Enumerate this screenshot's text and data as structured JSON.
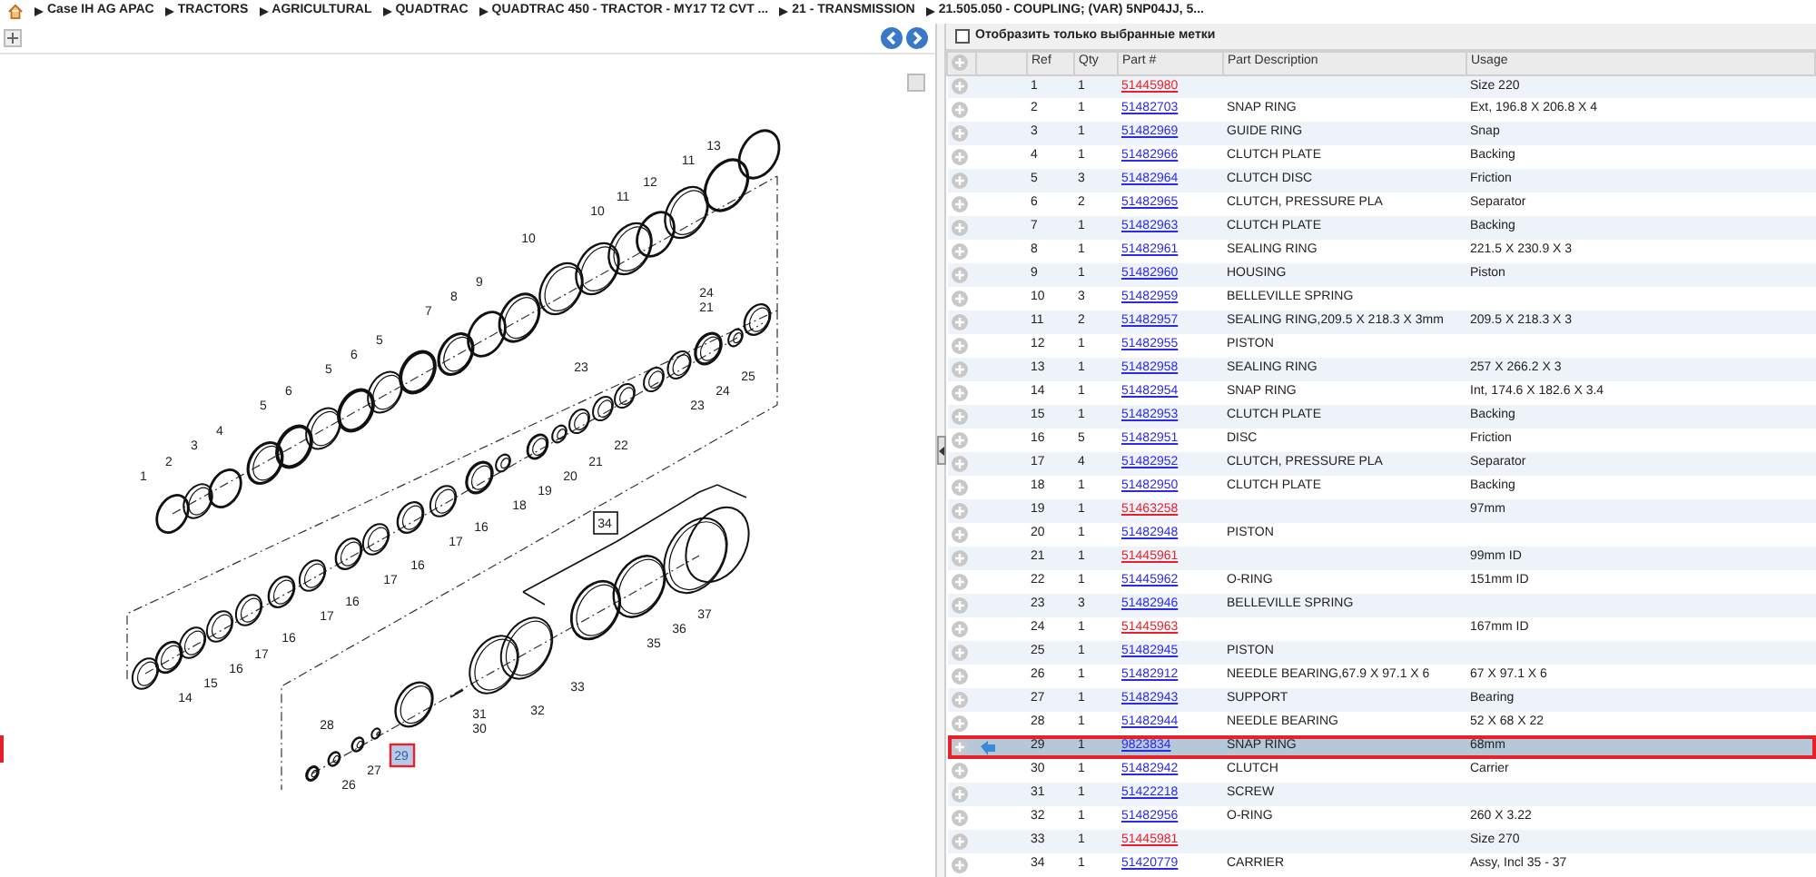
{
  "breadcrumb": [
    "Case IH AG APAC",
    "TRACTORS",
    "AGRICULTURAL",
    "QUADTRAC",
    "QUADTRAC 450 - TRACTOR - MY17 T2 CVT ...",
    "21 - TRANSMISSION",
    "21.505.050 - COUPLING; (VAR) 5NP04JJ, 5..."
  ],
  "diagram": {
    "callouts": [
      {
        "label": "1",
        "selected": false,
        "kind": "plain"
      },
      {
        "label": "2",
        "selected": false,
        "kind": "plain"
      },
      {
        "label": "3",
        "selected": false,
        "kind": "plain"
      },
      {
        "label": "4",
        "selected": false,
        "kind": "plain"
      },
      {
        "label": "5",
        "selected": false,
        "kind": "plain"
      },
      {
        "label": "6",
        "selected": false,
        "kind": "plain"
      },
      {
        "label": "5",
        "selected": false,
        "kind": "plain"
      },
      {
        "label": "6",
        "selected": false,
        "kind": "plain"
      },
      {
        "label": "5",
        "selected": false,
        "kind": "plain"
      },
      {
        "label": "7",
        "selected": false,
        "kind": "plain"
      },
      {
        "label": "8",
        "selected": false,
        "kind": "plain"
      },
      {
        "label": "9",
        "selected": false,
        "kind": "plain"
      },
      {
        "label": "10",
        "selected": false,
        "kind": "plain"
      },
      {
        "label": "10",
        "selected": false,
        "kind": "plain"
      },
      {
        "label": "11",
        "selected": false,
        "kind": "plain"
      },
      {
        "label": "12",
        "selected": false,
        "kind": "plain"
      },
      {
        "label": "11",
        "selected": false,
        "kind": "plain"
      },
      {
        "label": "13",
        "selected": false,
        "kind": "plain"
      },
      {
        "label": "24",
        "selected": false,
        "kind": "plain"
      },
      {
        "label": "21",
        "selected": false,
        "kind": "plain"
      },
      {
        "label": "25",
        "selected": false,
        "kind": "plain"
      },
      {
        "label": "24",
        "selected": false,
        "kind": "plain"
      },
      {
        "label": "23",
        "selected": false,
        "kind": "plain"
      },
      {
        "label": "23",
        "selected": false,
        "kind": "plain"
      },
      {
        "label": "22",
        "selected": false,
        "kind": "plain"
      },
      {
        "label": "21",
        "selected": false,
        "kind": "plain"
      },
      {
        "label": "20",
        "selected": false,
        "kind": "plain"
      },
      {
        "label": "19",
        "selected": false,
        "kind": "plain"
      },
      {
        "label": "18",
        "selected": false,
        "kind": "plain"
      },
      {
        "label": "16",
        "selected": false,
        "kind": "plain"
      },
      {
        "label": "17",
        "selected": false,
        "kind": "plain"
      },
      {
        "label": "16",
        "selected": false,
        "kind": "plain"
      },
      {
        "label": "17",
        "selected": false,
        "kind": "plain"
      },
      {
        "label": "16",
        "selected": false,
        "kind": "plain"
      },
      {
        "label": "17",
        "selected": false,
        "kind": "plain"
      },
      {
        "label": "16",
        "selected": false,
        "kind": "plain"
      },
      {
        "label": "17",
        "selected": false,
        "kind": "plain"
      },
      {
        "label": "16",
        "selected": false,
        "kind": "plain"
      },
      {
        "label": "15",
        "selected": false,
        "kind": "plain"
      },
      {
        "label": "14",
        "selected": false,
        "kind": "plain"
      },
      {
        "label": "34",
        "selected": false,
        "kind": "boxed"
      },
      {
        "label": "37",
        "selected": false,
        "kind": "plain"
      },
      {
        "label": "36",
        "selected": false,
        "kind": "plain"
      },
      {
        "label": "35",
        "selected": false,
        "kind": "plain"
      },
      {
        "label": "33",
        "selected": false,
        "kind": "plain"
      },
      {
        "label": "32",
        "selected": false,
        "kind": "plain"
      },
      {
        "label": "31",
        "selected": false,
        "kind": "plain"
      },
      {
        "label": "30",
        "selected": false,
        "kind": "plain"
      },
      {
        "label": "28",
        "selected": false,
        "kind": "plain"
      },
      {
        "label": "29",
        "selected": true,
        "kind": "plain"
      },
      {
        "label": "27",
        "selected": false,
        "kind": "plain"
      },
      {
        "label": "26",
        "selected": false,
        "kind": "plain"
      }
    ]
  },
  "filter": {
    "label": "Отобразить только выбранные метки",
    "checked": false
  },
  "table": {
    "columns": [
      "Ref",
      "Qty",
      "Part #",
      "Part Description",
      "Usage"
    ],
    "rows": [
      {
        "ref": "1",
        "qty": "1",
        "part": "51445980",
        "color": "#e8202a",
        "description": "",
        "usage": "Size 220",
        "selected": false
      },
      {
        "ref": "2",
        "qty": "1",
        "part": "51482703",
        "color": "#2a2ae8",
        "description": "SNAP RING",
        "usage": "Ext, 196.8 X 206.8 X 4",
        "selected": false
      },
      {
        "ref": "3",
        "qty": "1",
        "part": "51482969",
        "color": "#2a2ae8",
        "description": "GUIDE RING",
        "usage": "Snap",
        "selected": false
      },
      {
        "ref": "4",
        "qty": "1",
        "part": "51482966",
        "color": "#2a2ae8",
        "description": "CLUTCH PLATE",
        "usage": "Backing",
        "selected": false
      },
      {
        "ref": "5",
        "qty": "3",
        "part": "51482964",
        "color": "#2a2ae8",
        "description": "CLUTCH DISC",
        "usage": "Friction",
        "selected": false
      },
      {
        "ref": "6",
        "qty": "2",
        "part": "51482965",
        "color": "#2a2ae8",
        "description": "CLUTCH, PRESSURE PLA",
        "usage": "Separator",
        "selected": false
      },
      {
        "ref": "7",
        "qty": "1",
        "part": "51482963",
        "color": "#2a2ae8",
        "description": "CLUTCH PLATE",
        "usage": "Backing",
        "selected": false
      },
      {
        "ref": "8",
        "qty": "1",
        "part": "51482961",
        "color": "#2a2ae8",
        "description": "SEALING RING",
        "usage": "221.5 X 230.9 X 3",
        "selected": false
      },
      {
        "ref": "9",
        "qty": "1",
        "part": "51482960",
        "color": "#2a2ae8",
        "description": "HOUSING",
        "usage": "Piston",
        "selected": false
      },
      {
        "ref": "10",
        "qty": "3",
        "part": "51482959",
        "color": "#2a2ae8",
        "description": "BELLEVILLE SPRING",
        "usage": "",
        "selected": false
      },
      {
        "ref": "11",
        "qty": "2",
        "part": "51482957",
        "color": "#2a2ae8",
        "description": "SEALING RING,209.5 X 218.3 X 3mm",
        "usage": "209.5 X 218.3 X 3",
        "selected": false
      },
      {
        "ref": "12",
        "qty": "1",
        "part": "51482955",
        "color": "#2a2ae8",
        "description": "PISTON",
        "usage": "",
        "selected": false
      },
      {
        "ref": "13",
        "qty": "1",
        "part": "51482958",
        "color": "#2a2ae8",
        "description": "SEALING RING",
        "usage": "257 X 266.2 X 3",
        "selected": false
      },
      {
        "ref": "14",
        "qty": "1",
        "part": "51482954",
        "color": "#2a2ae8",
        "description": "SNAP RING",
        "usage": "Int, 174.6 X 182.6 X 3.4",
        "selected": false
      },
      {
        "ref": "15",
        "qty": "1",
        "part": "51482953",
        "color": "#2a2ae8",
        "description": "CLUTCH PLATE",
        "usage": "Backing",
        "selected": false
      },
      {
        "ref": "16",
        "qty": "5",
        "part": "51482951",
        "color": "#2a2ae8",
        "description": "DISC",
        "usage": "Friction",
        "selected": false
      },
      {
        "ref": "17",
        "qty": "4",
        "part": "51482952",
        "color": "#2a2ae8",
        "description": "CLUTCH, PRESSURE PLA",
        "usage": "Separator",
        "selected": false
      },
      {
        "ref": "18",
        "qty": "1",
        "part": "51482950",
        "color": "#2a2ae8",
        "description": "CLUTCH PLATE",
        "usage": "Backing",
        "selected": false
      },
      {
        "ref": "19",
        "qty": "1",
        "part": "51463258",
        "color": "#e8202a",
        "description": "",
        "usage": "97mm",
        "selected": false
      },
      {
        "ref": "20",
        "qty": "1",
        "part": "51482948",
        "color": "#2a2ae8",
        "description": "PISTON",
        "usage": "",
        "selected": false
      },
      {
        "ref": "21",
        "qty": "1",
        "part": "51445961",
        "color": "#e8202a",
        "description": "",
        "usage": "99mm ID",
        "selected": false
      },
      {
        "ref": "22",
        "qty": "1",
        "part": "51445962",
        "color": "#2a2ae8",
        "description": "O-RING",
        "usage": "151mm ID",
        "selected": false
      },
      {
        "ref": "23",
        "qty": "3",
        "part": "51482946",
        "color": "#2a2ae8",
        "description": "BELLEVILLE SPRING",
        "usage": "",
        "selected": false
      },
      {
        "ref": "24",
        "qty": "1",
        "part": "51445963",
        "color": "#e8202a",
        "description": "",
        "usage": "167mm ID",
        "selected": false
      },
      {
        "ref": "25",
        "qty": "1",
        "part": "51482945",
        "color": "#2a2ae8",
        "description": "PISTON",
        "usage": "",
        "selected": false
      },
      {
        "ref": "26",
        "qty": "1",
        "part": "51482912",
        "color": "#2a2ae8",
        "description": "NEEDLE BEARING,67.9 X 97.1 X 6",
        "usage": "67 X 97.1 X 6",
        "selected": false
      },
      {
        "ref": "27",
        "qty": "1",
        "part": "51482943",
        "color": "#2a2ae8",
        "description": "SUPPORT",
        "usage": "Bearing",
        "selected": false
      },
      {
        "ref": "28",
        "qty": "1",
        "part": "51482944",
        "color": "#2a2ae8",
        "description": "NEEDLE BEARING",
        "usage": "52 X 68 X 22",
        "selected": false
      },
      {
        "ref": "29",
        "qty": "1",
        "part": "9823834",
        "color": "#2a2ae8",
        "description": "SNAP RING",
        "usage": "68mm",
        "selected": true
      },
      {
        "ref": "30",
        "qty": "1",
        "part": "51482942",
        "color": "#2a2ae8",
        "description": "CLUTCH",
        "usage": "Carrier",
        "selected": false
      },
      {
        "ref": "31",
        "qty": "1",
        "part": "51422218",
        "color": "#2a2ae8",
        "description": "SCREW",
        "usage": "",
        "selected": false
      },
      {
        "ref": "32",
        "qty": "1",
        "part": "51482956",
        "color": "#2a2ae8",
        "description": "O-RING",
        "usage": "260 X 3.22",
        "selected": false
      },
      {
        "ref": "33",
        "qty": "1",
        "part": "51445981",
        "color": "#e8202a",
        "description": "",
        "usage": "Size 270",
        "selected": false
      },
      {
        "ref": "34",
        "qty": "1",
        "part": "51420779",
        "color": "#2a2ae8",
        "description": "CARRIER",
        "usage": "Assy, Incl 35 - 37",
        "selected": false
      }
    ]
  }
}
